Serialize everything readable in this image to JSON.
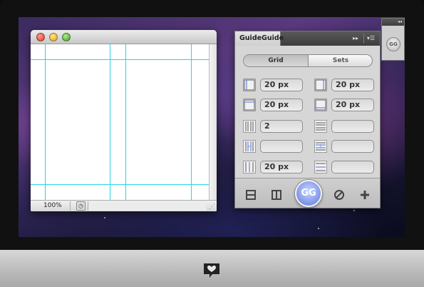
{
  "document_window": {
    "zoom_level": "100%"
  },
  "panel": {
    "title": "GuideGuide",
    "forward_icon": "▸▸",
    "menu_icon": "▾☰",
    "tabs": [
      "Grid",
      "Sets"
    ],
    "fields": [
      {
        "left": "20 px",
        "right": "20 px"
      },
      {
        "left": "20 px",
        "right": "20 px"
      },
      {
        "left": "2",
        "right": ""
      },
      {
        "left": "",
        "right": ""
      },
      {
        "left": "20 px",
        "right": ""
      }
    ],
    "gg_button": "GG"
  },
  "dock": {
    "collapse_icon": "◂◂",
    "button_label": "GG"
  },
  "colors": {
    "guide": "#2ad4e6",
    "gg_button": "#7c93e8"
  }
}
